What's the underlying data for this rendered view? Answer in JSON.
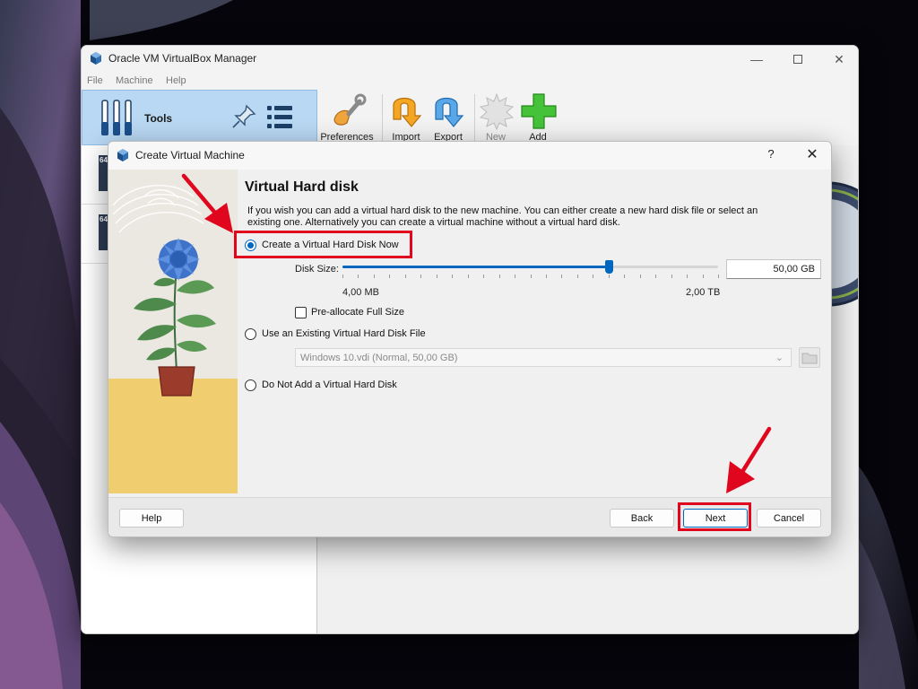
{
  "main_window": {
    "title": "Oracle VM VirtualBox Manager",
    "menu": [
      "File",
      "Machine",
      "Help"
    ],
    "tools_label": "Tools",
    "toolbar": {
      "preferences": "Preferences",
      "import": "Import",
      "export": "Export",
      "new": "New",
      "add": "Add"
    },
    "vm_badges": [
      "64",
      "64"
    ]
  },
  "dialog": {
    "title": "Create Virtual Machine",
    "help_glyph": "?",
    "close_glyph": "✕",
    "heading": "Virtual Hard disk",
    "description": "If you wish you can add a virtual hard disk to the new machine. You can either create a new hard disk file or select an existing one. Alternatively you can create a virtual machine without a virtual hard disk.",
    "options": {
      "create_now": "Create a Virtual Hard Disk Now",
      "use_existing": "Use an Existing Virtual Hard Disk File",
      "no_disk": "Do Not Add a Virtual Hard Disk"
    },
    "selected_option": "create_now",
    "disk_size_label": "Disk Size:",
    "disk_size_value": "50,00 GB",
    "slider_min_label": "4,00 MB",
    "slider_max_label": "2,00 TB",
    "slider_fraction": 0.71,
    "preallocate_label": "Pre-allocate Full Size",
    "preallocate_checked": false,
    "existing_disk_value": "Windows 10.vdi (Normal, 50,00 GB)",
    "buttons": {
      "help": "Help",
      "back": "Back",
      "next": "Next",
      "cancel": "Cancel"
    }
  },
  "colors": {
    "accent": "#0067c0",
    "annotation_red": "#e0061d",
    "tools_bg": "#b9d8f3"
  }
}
